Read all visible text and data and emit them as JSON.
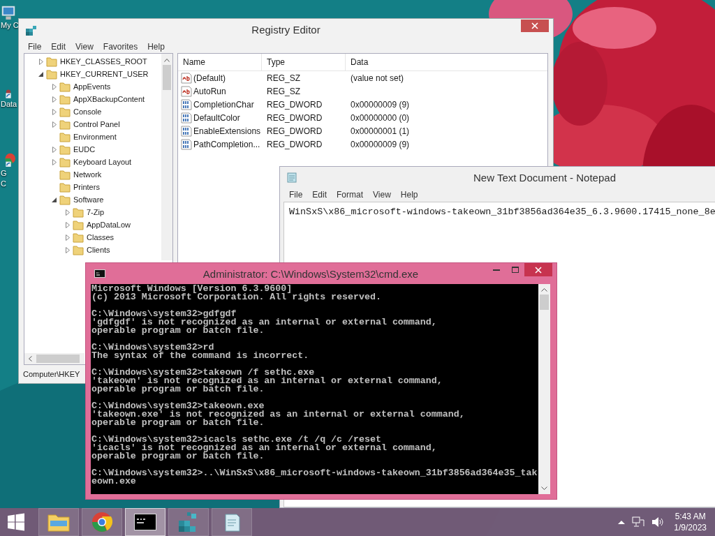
{
  "desktop_icons": [
    {
      "kind": "computer",
      "lines": [
        "My C"
      ]
    },
    {
      "kind": "shortcut",
      "lines": [
        "Data"
      ]
    },
    {
      "kind": "chrome",
      "lines": [
        "G",
        "C"
      ]
    }
  ],
  "registry_editor": {
    "title": "Registry Editor",
    "menu": [
      "File",
      "Edit",
      "View",
      "Favorites",
      "Help"
    ],
    "tree": [
      {
        "label": "HKEY_CLASSES_ROOT",
        "expanded": false
      },
      {
        "label": "HKEY_CURRENT_USER",
        "expanded": true,
        "children": [
          {
            "label": "AppEvents",
            "expanded": false
          },
          {
            "label": "AppXBackupContent",
            "expanded": false
          },
          {
            "label": "Console",
            "expanded": false
          },
          {
            "label": "Control Panel",
            "expanded": false
          },
          {
            "label": "Environment"
          },
          {
            "label": "EUDC",
            "expanded": false
          },
          {
            "label": "Keyboard Layout",
            "expanded": false
          },
          {
            "label": "Network"
          },
          {
            "label": "Printers"
          },
          {
            "label": "Software",
            "expanded": true,
            "children": [
              {
                "label": "7-Zip",
                "expanded": false
              },
              {
                "label": "AppDataLow",
                "expanded": false
              },
              {
                "label": "Classes",
                "expanded": false
              },
              {
                "label": "Clients",
                "expanded": false
              }
            ]
          }
        ]
      }
    ],
    "columns": [
      "Name",
      "Type",
      "Data"
    ],
    "values": [
      {
        "kind": "string",
        "name": "(Default)",
        "type": "REG_SZ",
        "data": "(value not set)"
      },
      {
        "kind": "string",
        "name": "AutoRun",
        "type": "REG_SZ"
      },
      {
        "kind": "dword",
        "name": "CompletionChar",
        "type": "REG_DWORD",
        "data": "0x00000009 (9)"
      },
      {
        "kind": "dword",
        "name": "DefaultColor",
        "type": "REG_DWORD",
        "data": "0x00000000 (0)"
      },
      {
        "kind": "dword",
        "name": "EnableExtensions",
        "type": "REG_DWORD",
        "data": "0x00000001 (1)"
      },
      {
        "kind": "dword",
        "name": "PathCompletion...",
        "type": "REG_DWORD",
        "data": "0x00000009 (9)"
      }
    ],
    "status": "Computer\\HKEY"
  },
  "notepad": {
    "title": "New Text Document - Notepad",
    "menu": [
      "File",
      "Edit",
      "Format",
      "View",
      "Help"
    ],
    "text": "WinSxS\\x86_microsoft-windows-takeown_31bf3856ad364e35_6.3.9600.17415_none_8e"
  },
  "cmd": {
    "title": "Administrator: C:\\Windows\\System32\\cmd.exe",
    "blocks": [
      [
        "Microsoft Windows [Version 6.3.9600]",
        "(c) 2013 Microsoft Corporation. All rights reserved."
      ],
      [
        "C:\\Windows\\system32>gdfgdf",
        "'gdfgdf' is not recognized as an internal or external command,",
        "operable program or batch file."
      ],
      [
        "C:\\Windows\\system32>rd",
        "The syntax of the command is incorrect."
      ],
      [
        "C:\\Windows\\system32>takeown /f sethc.exe",
        "'takeown' is not recognized as an internal or external command,",
        "operable program or batch file."
      ],
      [
        "C:\\Windows\\system32>takeown.exe",
        "'takeown.exe' is not recognized as an internal or external command,",
        "operable program or batch file."
      ],
      [
        "C:\\Windows\\system32>icacls sethc.exe /t /q /c /reset",
        "'icacls' is not recognized as an internal or external command,",
        "operable program or batch file."
      ],
      [
        "C:\\Windows\\system32>..\\WinSxS\\x86_microsoft-windows-takeown_31bf3856ad364e35_tak",
        "eown.exe"
      ]
    ]
  },
  "taskbar": {
    "apps": [
      {
        "kind": "explorer",
        "selected": false
      },
      {
        "kind": "chrome",
        "selected": false
      },
      {
        "kind": "cmd",
        "selected": true
      },
      {
        "kind": "regedit",
        "selected": false
      },
      {
        "kind": "notepad",
        "selected": false
      }
    ],
    "time": "5:43 AM",
    "date": "1/9/2023"
  }
}
